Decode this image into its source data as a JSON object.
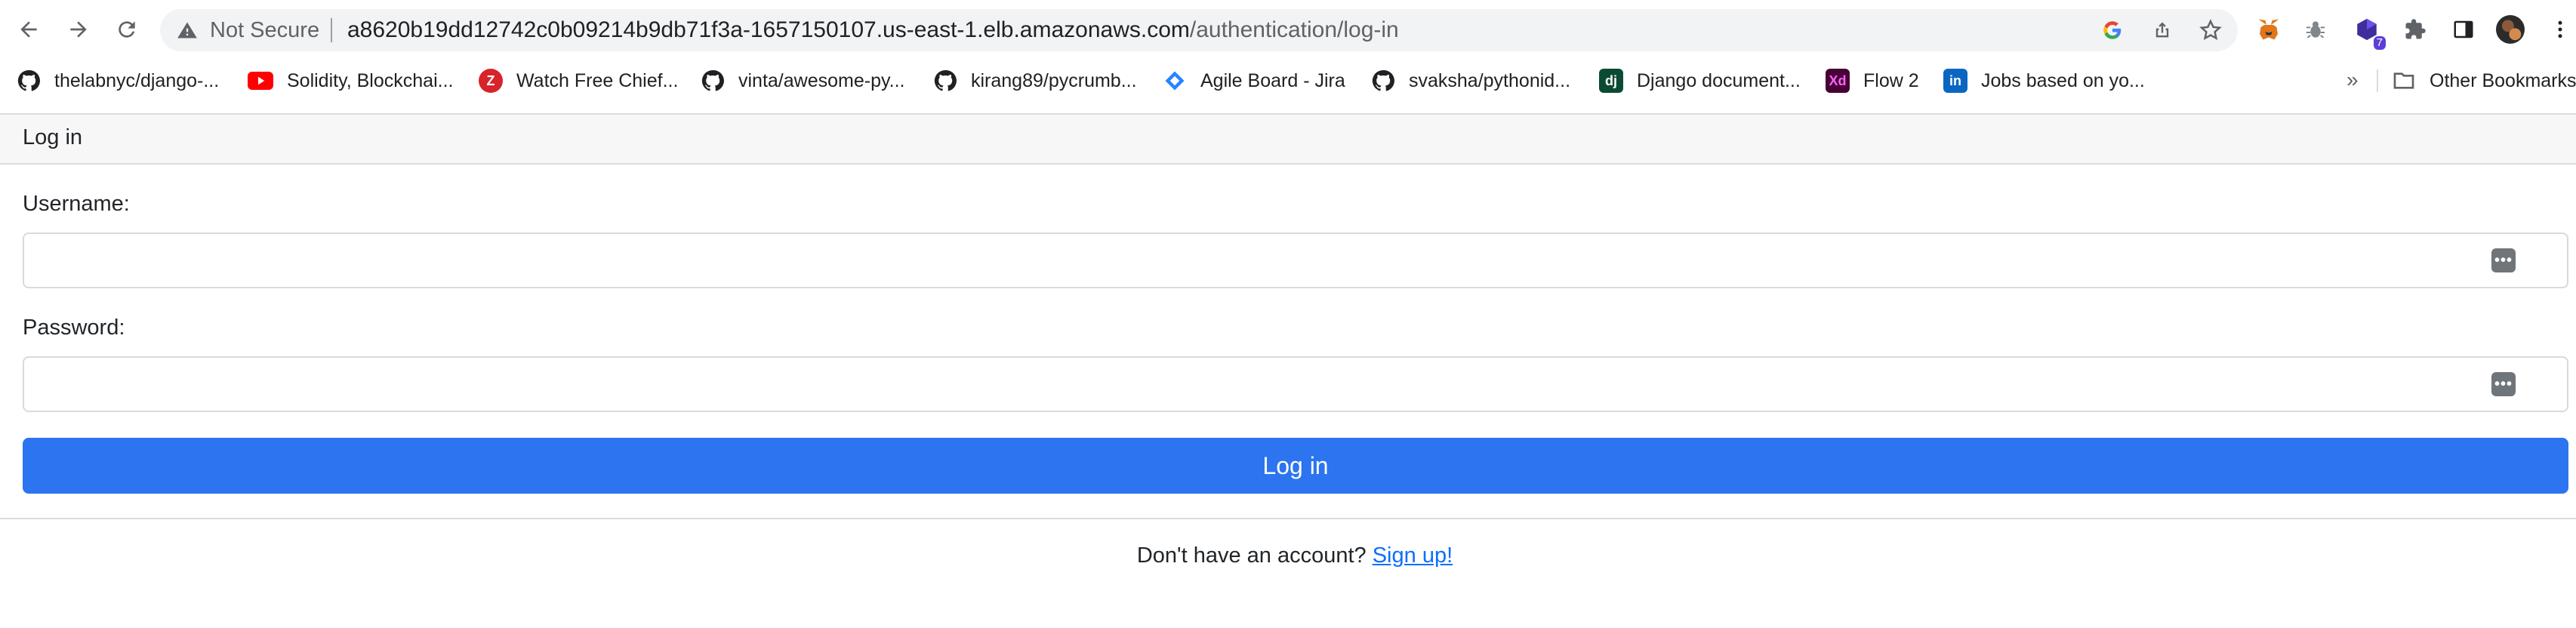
{
  "browser": {
    "address_bar": {
      "security_label": "Not Secure",
      "url_host": "a8620b19dd12742c0b09214b9db71f3a-1657150107.us-east-1.elb.amazonaws.com",
      "url_path": "/authentication/log-in"
    },
    "extensions": [
      {
        "name": "metamask-fox-icon"
      },
      {
        "name": "bug-icon"
      },
      {
        "name": "cube-extension-icon",
        "badge": "7"
      },
      {
        "name": "puzzle-extensions-icon"
      },
      {
        "name": "side-panel-icon"
      },
      {
        "name": "profile-avatar"
      },
      {
        "name": "kebab-menu-icon"
      }
    ],
    "bookmarks": [
      {
        "label": "thelabnyc/django-...",
        "icon": "github-icon"
      },
      {
        "label": "Solidity, Blockchai...",
        "icon": "youtube-icon"
      },
      {
        "label": "Watch Free Chief...",
        "icon": "red-z-icon"
      },
      {
        "label": "vinta/awesome-py...",
        "icon": "github-icon"
      },
      {
        "label": "kirang89/pycrumb...",
        "icon": "github-icon"
      },
      {
        "label": "Agile Board - Jira",
        "icon": "jira-icon"
      },
      {
        "label": "svaksha/pythonid...",
        "icon": "github-icon"
      },
      {
        "label": "Django document...",
        "icon": "django-icon",
        "icon_text": "dj"
      },
      {
        "label": "Flow 2",
        "icon": "adobe-xd-icon",
        "icon_text": "Xd"
      },
      {
        "label": "Jobs based on yo...",
        "icon": "linkedin-icon",
        "icon_text": "in"
      }
    ],
    "bookmarks_overflow": "»",
    "other_bookmarks": "Other Bookmarks"
  },
  "login": {
    "card_title": "Log in",
    "username_label": "Username:",
    "username_value": "",
    "password_label": "Password:",
    "password_value": "",
    "submit_label": "Log in",
    "signup_prompt": "Don't have an account?",
    "signup_link": "Sign up!"
  },
  "colors": {
    "primary_button": "#2c74f0",
    "link": "#0d6efd",
    "header_bg": "#f7f7f7"
  }
}
